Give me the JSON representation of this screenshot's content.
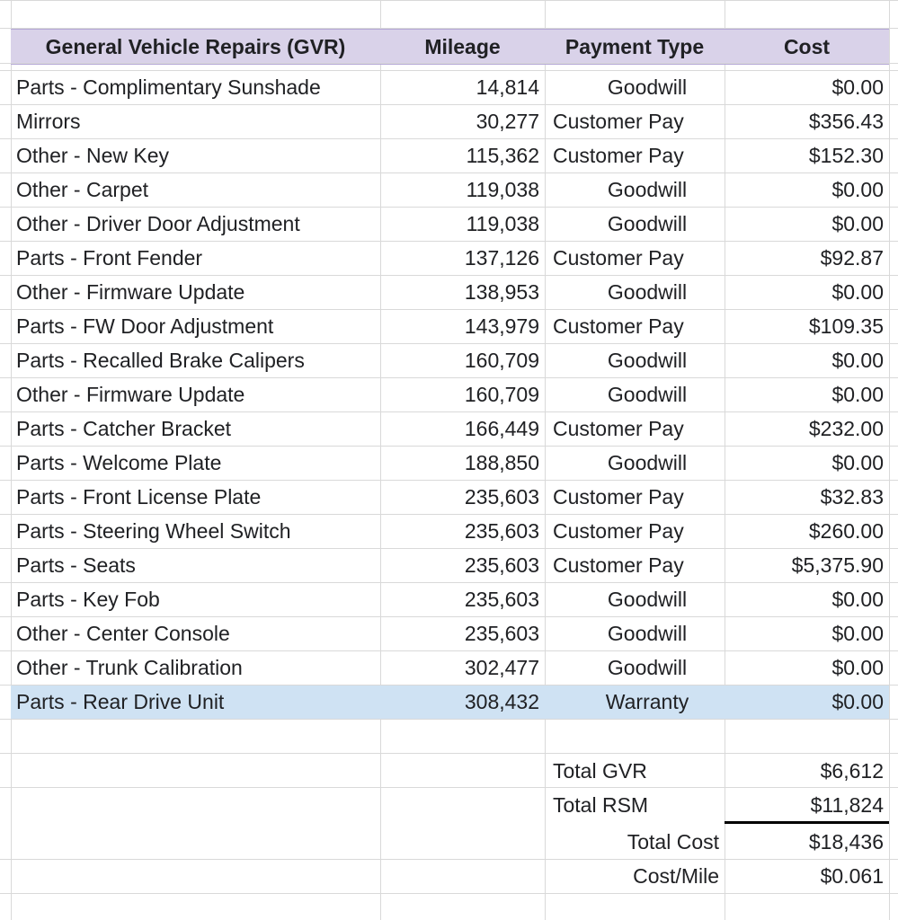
{
  "header": {
    "col1": "General Vehicle Repairs (GVR)",
    "col2": "Mileage",
    "col3": "Payment Type",
    "col4": "Cost",
    "bg_color": "#d9d2e9"
  },
  "rows": [
    {
      "item": "Parts - Complimentary Sunshade",
      "mileage": "14,814",
      "payment": "Goodwill",
      "cost": "$0.00"
    },
    {
      "item": "Mirrors",
      "mileage": "30,277",
      "payment": "Customer Pay",
      "cost": "$356.43"
    },
    {
      "item": "Other - New Key",
      "mileage": "115,362",
      "payment": "Customer Pay",
      "cost": "$152.30"
    },
    {
      "item": "Other - Carpet",
      "mileage": "119,038",
      "payment": "Goodwill",
      "cost": "$0.00"
    },
    {
      "item": "Other - Driver Door Adjustment",
      "mileage": "119,038",
      "payment": "Goodwill",
      "cost": "$0.00"
    },
    {
      "item": "Parts - Front Fender",
      "mileage": "137,126",
      "payment": "Customer Pay",
      "cost": "$92.87"
    },
    {
      "item": "Other - Firmware Update",
      "mileage": "138,953",
      "payment": "Goodwill",
      "cost": "$0.00"
    },
    {
      "item": "Parts - FW Door Adjustment",
      "mileage": "143,979",
      "payment": "Customer Pay",
      "cost": "$109.35"
    },
    {
      "item": "Parts - Recalled Brake Calipers",
      "mileage": "160,709",
      "payment": "Goodwill",
      "cost": "$0.00"
    },
    {
      "item": "Other - Firmware Update",
      "mileage": "160,709",
      "payment": "Goodwill",
      "cost": "$0.00"
    },
    {
      "item": "Parts - Catcher Bracket",
      "mileage": "166,449",
      "payment": "Customer Pay",
      "cost": "$232.00"
    },
    {
      "item": "Parts - Welcome Plate",
      "mileage": "188,850",
      "payment": "Goodwill",
      "cost": "$0.00"
    },
    {
      "item": "Parts - Front License Plate",
      "mileage": "235,603",
      "payment": "Customer Pay",
      "cost": "$32.83"
    },
    {
      "item": "Parts - Steering Wheel Switch",
      "mileage": "235,603",
      "payment": "Customer Pay",
      "cost": "$260.00"
    },
    {
      "item": "Parts - Seats",
      "mileage": "235,603",
      "payment": "Customer Pay",
      "cost": "$5,375.90"
    },
    {
      "item": "Parts - Key Fob",
      "mileage": "235,603",
      "payment": "Goodwill",
      "cost": "$0.00"
    },
    {
      "item": "Other - Center Console",
      "mileage": "235,603",
      "payment": "Goodwill",
      "cost": "$0.00"
    },
    {
      "item": "Other - Trunk Calibration",
      "mileage": "302,477",
      "payment": "Goodwill",
      "cost": "$0.00"
    },
    {
      "item": "Parts - Rear Drive Unit",
      "mileage": "308,432",
      "payment": "Warranty",
      "cost": "$0.00",
      "selected": true
    }
  ],
  "summary": {
    "total_gvr_label": "Total GVR",
    "total_gvr_value": "$6,612",
    "total_rsm_label": "Total RSM",
    "total_rsm_value": "$11,824",
    "total_cost_label": "Total Cost",
    "total_cost_value": "$18,436",
    "cost_per_mile_label": "Cost/Mile",
    "cost_per_mile_value": "$0.061"
  },
  "colors": {
    "selected_row": "#cfe2f3",
    "gridline": "#d9d9d9"
  }
}
